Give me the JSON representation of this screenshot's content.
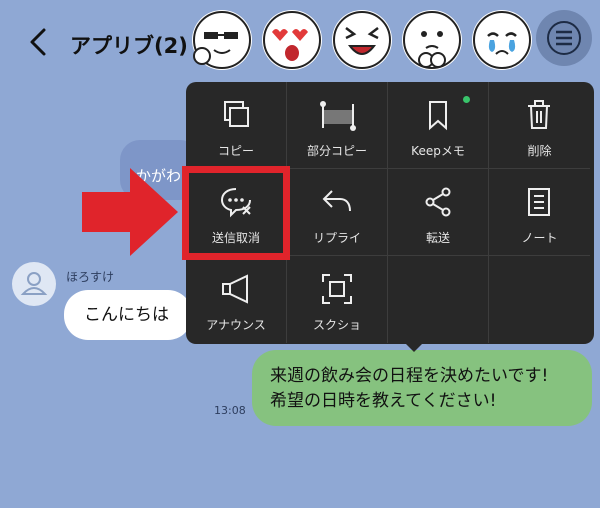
{
  "header": {
    "title": "アプリブ(2)",
    "back_icon": "chevron-left-icon",
    "menu_icon": "menu-lines-icon"
  },
  "colors": {
    "background": "#8fa8d4",
    "popup": "#282828",
    "outgoing_bubble": "#86c27f",
    "highlight": "#e0242b",
    "online_dot": "#39c46b"
  },
  "chat": {
    "hidden_message": "かがわ",
    "sender": "ほろすけ",
    "incoming_message": "こんにちは",
    "outgoing_lines": [
      "来週の飲み会の日程を決めたいです!",
      "希望の日時を教えてください!"
    ],
    "time": "13:08"
  },
  "menu": {
    "items": [
      {
        "label": "コピー",
        "icon": "copy-icon"
      },
      {
        "label": "部分コピー",
        "icon": "partial-copy-icon"
      },
      {
        "label": "Keepメモ",
        "icon": "bookmark-icon"
      },
      {
        "label": "削除",
        "icon": "trash-icon"
      },
      {
        "label": "送信取消",
        "icon": "unsend-icon"
      },
      {
        "label": "リプライ",
        "icon": "reply-icon"
      },
      {
        "label": "転送",
        "icon": "share-icon"
      },
      {
        "label": "ノート",
        "icon": "note-icon"
      },
      {
        "label": "アナウンス",
        "icon": "megaphone-icon"
      },
      {
        "label": "スクショ",
        "icon": "screenshot-icon"
      }
    ]
  }
}
